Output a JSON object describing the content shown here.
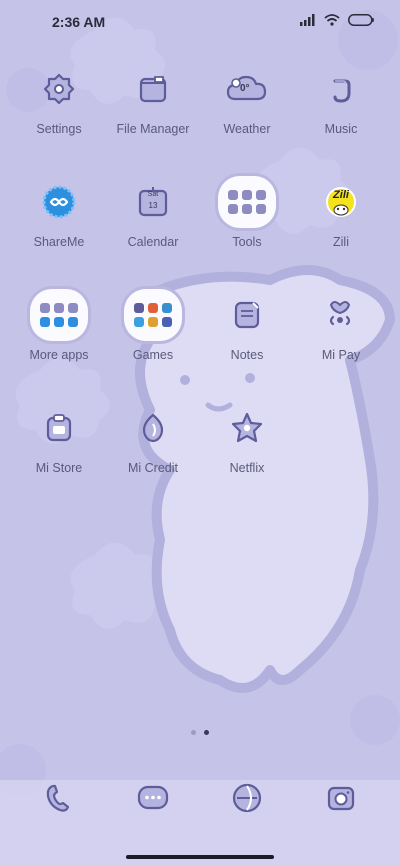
{
  "status": {
    "time": "2:36 AM"
  },
  "apps": [
    {
      "label": "Settings",
      "icon": "settings-icon"
    },
    {
      "label": "File Manager",
      "icon": "folder-icon"
    },
    {
      "label": "Weather",
      "icon": "cloud-icon",
      "badge": "0°"
    },
    {
      "label": "Music",
      "icon": "music-icon"
    },
    {
      "label": "ShareMe",
      "icon": "shareme-icon"
    },
    {
      "label": "Calendar",
      "icon": "calendar-icon",
      "day": "Sat",
      "date": "13"
    },
    {
      "label": "Tools",
      "icon": "tools-folder-icon"
    },
    {
      "label": "Zili",
      "icon": "zili-icon",
      "text": "Zili"
    },
    {
      "label": "More apps",
      "icon": "more-apps-folder-icon"
    },
    {
      "label": "Games",
      "icon": "games-folder-icon"
    },
    {
      "label": "Notes",
      "icon": "notes-icon"
    },
    {
      "label": "Mi Pay",
      "icon": "mipay-icon"
    },
    {
      "label": "Mi Store",
      "icon": "store-icon"
    },
    {
      "label": "Mi Credit",
      "icon": "credit-icon"
    },
    {
      "label": "Netflix",
      "icon": "star-flower-icon"
    }
  ],
  "dock": [
    {
      "icon": "phone-icon"
    },
    {
      "icon": "messages-icon"
    },
    {
      "icon": "browser-icon"
    },
    {
      "icon": "camera-icon"
    }
  ],
  "page_indicator": {
    "pages": 2,
    "active": 2
  },
  "colors": {
    "background": "#c5c3e8",
    "icon_stroke": "#5f5d99",
    "icon_fill": "#b5b3e0",
    "shareme": "#2d8fe0",
    "zili": "#f4e21c"
  }
}
